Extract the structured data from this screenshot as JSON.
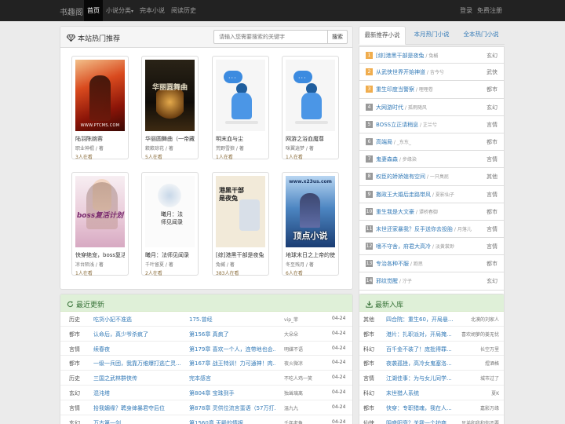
{
  "navbar": {
    "brand": "书趣阁",
    "items": [
      {
        "label": "首页",
        "active": true
      },
      {
        "label": "小说分类",
        "caret": "▾"
      },
      {
        "label": "完本小说"
      },
      {
        "label": "阅读历史"
      }
    ],
    "right": [
      {
        "label": "登录"
      },
      {
        "label": "免费注册"
      }
    ]
  },
  "hot": {
    "title": "本站热门推荐",
    "icon": "diamond-icon",
    "search_placeholder": "请输入您需要搜索的关键字",
    "search_button": "搜索",
    "books": [
      {
        "title": "陆羽陈婉蓉",
        "author": "职业神棍 / 著",
        "readers": "3人在看",
        "cover": "red"
      },
      {
        "title": "华丽圆舞曲（一帝藏",
        "author": "簌簌琼花 / 著",
        "readers": "5人在看",
        "cover": "dark",
        "cover_text": "华丽圆舞曲"
      },
      {
        "title": "明末血与尘",
        "author": "荒野雪狼 / 著",
        "readers": "1人在看",
        "cover": "placeholder"
      },
      {
        "title": "网游之浴血魔尊",
        "author": "咪翼逍梦 / 著",
        "readers": "1人在看",
        "cover": "placeholder"
      },
      {
        "title": "快穿绝宠，boss复活",
        "author": "凉台陌浅 / 著",
        "readers": "1人在看",
        "cover": "pink",
        "cover_text": "boss复活计划"
      },
      {
        "title": "曦月：法师见闻录",
        "author": "千叶留夏 / 著",
        "readers": "2人在看",
        "cover": "white",
        "cover_text": "曦月：法师见闻录"
      },
      {
        "title": "[综]港黑干部是夜兔",
        "author": "兔槭 / 著",
        "readers": "383人在看",
        "cover": "beige",
        "cover_text": "港黑干部是夜兔"
      },
      {
        "title": "地球末日之上帝的使",
        "author": "冬至残月 / 著",
        "readers": "6人在看",
        "cover": "blue",
        "cover_text": "顶点小说",
        "cover_url": "www.x23us.com"
      }
    ]
  },
  "rank": {
    "tabs": [
      {
        "label": "最新推荐小说",
        "active": true
      },
      {
        "label": "本月热门小说"
      },
      {
        "label": "全本热门小说"
      }
    ],
    "items": [
      {
        "n": "1",
        "title": "[综]港黑干部是夜兔",
        "author": "兔槭",
        "genre": "玄幻"
      },
      {
        "n": "2",
        "title": "从武侠世界开始神道",
        "author": "吉今兮",
        "genre": "武侠"
      },
      {
        "n": "3",
        "title": "重生印度当警察",
        "author": "哩哩卷",
        "genre": "都市"
      },
      {
        "n": "4",
        "title": "大网游时代",
        "author": "孤雨随风",
        "genre": "玄幻"
      },
      {
        "n": "5",
        "title": "BOSS立正请稍息",
        "author": "芷兰兮",
        "genre": "言情"
      },
      {
        "n": "6",
        "title": "高端局",
        "author": "_东东_",
        "genre": "都市"
      },
      {
        "n": "7",
        "title": "鬼妻森森",
        "author": "步缘染",
        "genre": "言情"
      },
      {
        "n": "8",
        "title": "权臣的娇娇媳有空间",
        "author": "一只臭屁",
        "genre": "其他"
      },
      {
        "n": "9",
        "title": "撒政王大婚后走路带风",
        "author": "夏影仙子",
        "genre": "言情"
      },
      {
        "n": "10",
        "title": "重生我是大文豪",
        "author": "谭桥春御",
        "genre": "都市"
      },
      {
        "n": "11",
        "title": "末世还家暴我？反手送你去投胎",
        "author": "月落儿",
        "genre": "言情"
      },
      {
        "n": "12",
        "title": "嗜不守舍，府君大高冷",
        "author": "淡黄裳渺",
        "genre": "言情"
      },
      {
        "n": "13",
        "title": "专治各种不服",
        "author": "跑思",
        "genre": "都市"
      },
      {
        "n": "14",
        "title": "邪纹觉醒",
        "author": "泞子",
        "genre": "玄幻"
      },
      {
        "n": "15",
        "title": "爱情不言别",
        "author": "六月丁香",
        "genre": "言情"
      }
    ]
  },
  "latest": {
    "title": "最近更新",
    "icon": "refresh-icon",
    "rows": [
      {
        "genre": "历史",
        "book": "吃货小妃不准逃",
        "chapter": "175.曾经",
        "author": "vip_菲",
        "date": "04-24"
      },
      {
        "genre": "都市",
        "book": "认命后，真少爷杀疯了",
        "chapter": "第156章 真疯了",
        "author": "大朵朵",
        "date": "04-24"
      },
      {
        "genre": "言情",
        "book": "续春夜",
        "chapter": "第179章 喜欢一个人，连带地也会...",
        "author": "明媒不语",
        "date": "04-24"
      },
      {
        "genre": "都市",
        "book": "一级一兵团，我靠万维爆打逃亡灵...",
        "chapter": "第167章 战王特训！力可通神！肉...",
        "author": "夜火微凉",
        "date": "04-24"
      },
      {
        "genre": "历史",
        "book": "三国之武林群侠传",
        "chapter": "完本感言",
        "author": "不吃人鸡一笑",
        "date": "04-24"
      },
      {
        "genre": "玄幻",
        "book": "混沌塔",
        "chapter": "第804章 宝珠到手",
        "author": "独耸璃离",
        "date": "04-24"
      },
      {
        "genre": "言情",
        "book": "拾我媚缘？聘身婶暴君夺后位",
        "chapter": "第878章 灵供位流言蜚语（57万打...",
        "author": "温九九",
        "date": "04-24"
      },
      {
        "genre": "玄幻",
        "book": "万古第一剑",
        "chapter": "第1560章 天殿的情报",
        "author": "千年老龟",
        "date": "04-24"
      }
    ]
  },
  "newbooks": {
    "title": "最新入库",
    "icon": "download-icon",
    "rows": [
      {
        "genre": "其他",
        "book": "四合院：重生60，开局悬...",
        "author": "北漠的刘家人"
      },
      {
        "genre": "都市",
        "book": "港片：扎职派对，开局掩...",
        "author": "喜欢胡萝的姜无忧"
      },
      {
        "genre": "科幻",
        "book": "百千金不装了！庞批得罪...",
        "author": "长空万里"
      },
      {
        "genre": "都市",
        "book": "夜袭孤挫，高冷女鬼塞洛...",
        "author": "煜酒格"
      },
      {
        "genre": "言情",
        "book": "江湖佳事：为与女儿同学...",
        "author": "城市过了"
      },
      {
        "genre": "科幻",
        "book": "末世猎人系统",
        "author": "夏K"
      },
      {
        "genre": "都市",
        "book": "快穿：专职猎魂，我在人...",
        "author": "嘉影万缘"
      },
      {
        "genre": "仙侠",
        "book": "阴盛阳衰？关我一个护商...",
        "author": "兄弟和我和你不要"
      }
    ]
  },
  "colors": {
    "navbar": "#222222",
    "link": "#337ab7",
    "latest_header": "#dff0d8",
    "rank_top": "#f0ad4e"
  }
}
